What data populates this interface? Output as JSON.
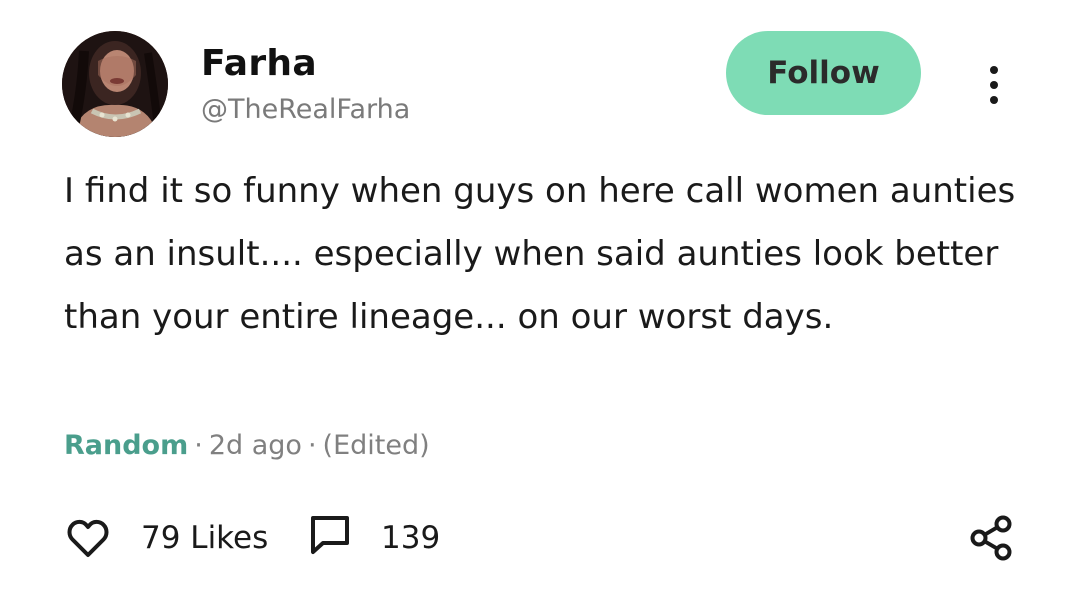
{
  "author": {
    "name": "Farha",
    "handle": "@TheRealFarha"
  },
  "follow_label": "Follow",
  "post": {
    "text": "I find it so funny when guys on here call women aunties as an insult.... especially when said aunties look better than your entire lineage... on our worst days.",
    "category": "Random",
    "time": "2d ago",
    "edited": "(Edited)",
    "meta_sep": "·"
  },
  "stats": {
    "likes": "79 Likes",
    "comments": "139"
  },
  "icons": {
    "more": "more-vertical-icon",
    "like": "heart-icon",
    "comment": "comment-icon",
    "share": "share-icon"
  },
  "colors": {
    "follow_bg": "#7edcb5",
    "category": "#4a9e8c",
    "meta": "#808080",
    "text": "#1a1a1a"
  }
}
